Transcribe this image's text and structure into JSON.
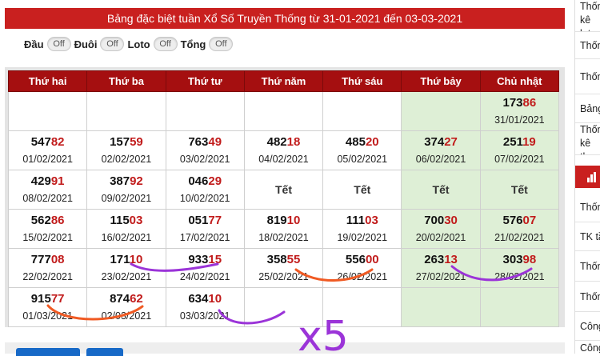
{
  "header": {
    "title": "Bảng đặc biệt tuần Xổ Số Truyền Thống từ 31-01-2021 đến 03-03-2021"
  },
  "toggles": [
    {
      "label": "Đầu",
      "state": "Off"
    },
    {
      "label": "Đuôi",
      "state": "Off"
    },
    {
      "label": "Loto",
      "state": "Off"
    },
    {
      "label": "Tổng",
      "state": "Off"
    }
  ],
  "table": {
    "headers": [
      "Thứ hai",
      "Thứ ba",
      "Thứ tư",
      "Thứ năm",
      "Thứ sáu",
      "Thứ bảy",
      "Chủ nhật"
    ],
    "rows": [
      [
        {
          "head": "",
          "tail": "",
          "date": ""
        },
        {
          "head": "",
          "tail": "",
          "date": ""
        },
        {
          "head": "",
          "tail": "",
          "date": ""
        },
        {
          "head": "",
          "tail": "",
          "date": ""
        },
        {
          "head": "",
          "tail": "",
          "date": ""
        },
        {
          "head": "",
          "tail": "",
          "date": ""
        },
        {
          "head": "173",
          "tail": "86",
          "date": "31/01/2021"
        }
      ],
      [
        {
          "head": "547",
          "tail": "82",
          "date": "01/02/2021"
        },
        {
          "head": "157",
          "tail": "59",
          "date": "02/02/2021"
        },
        {
          "head": "763",
          "tail": "49",
          "date": "03/02/2021"
        },
        {
          "head": "482",
          "tail": "18",
          "date": "04/02/2021"
        },
        {
          "head": "485",
          "tail": "20",
          "date": "05/02/2021"
        },
        {
          "head": "374",
          "tail": "27",
          "date": "06/02/2021"
        },
        {
          "head": "251",
          "tail": "19",
          "date": "07/02/2021"
        }
      ],
      [
        {
          "head": "429",
          "tail": "91",
          "date": "08/02/2021"
        },
        {
          "head": "387",
          "tail": "92",
          "date": "09/02/2021"
        },
        {
          "head": "046",
          "tail": "29",
          "date": "10/02/2021"
        },
        {
          "tet": "Tết"
        },
        {
          "tet": "Tết"
        },
        {
          "tet": "Tết"
        },
        {
          "tet": "Tết"
        }
      ],
      [
        {
          "head": "562",
          "tail": "86",
          "date": "15/02/2021"
        },
        {
          "head": "115",
          "tail": "03",
          "date": "16/02/2021"
        },
        {
          "head": "051",
          "tail": "77",
          "date": "17/02/2021"
        },
        {
          "head": "819",
          "tail": "10",
          "date": "18/02/2021"
        },
        {
          "head": "111",
          "tail": "03",
          "date": "19/02/2021"
        },
        {
          "head": "700",
          "tail": "30",
          "date": "20/02/2021"
        },
        {
          "head": "576",
          "tail": "07",
          "date": "21/02/2021"
        }
      ],
      [
        {
          "head": "777",
          "tail": "08",
          "date": "22/02/2021"
        },
        {
          "head": "171",
          "tail": "10",
          "date": "23/02/2021"
        },
        {
          "head": "933",
          "tail": "15",
          "date": "24/02/2021"
        },
        {
          "head": "358",
          "tail": "55",
          "date": "25/02/2021"
        },
        {
          "head": "556",
          "tail": "00",
          "date": "26/02/2021"
        },
        {
          "head": "263",
          "tail": "13",
          "date": "27/02/2021"
        },
        {
          "head": "303",
          "tail": "98",
          "date": "28/02/2021"
        }
      ],
      [
        {
          "head": "915",
          "tail": "77",
          "date": "01/03/2021"
        },
        {
          "head": "874",
          "tail": "62",
          "date": "02/03/2021"
        },
        {
          "head": "634",
          "tail": "10",
          "date": "03/03/2021"
        },
        {
          "head": "",
          "tail": "",
          "date": ""
        },
        {
          "head": "",
          "tail": "",
          "date": ""
        },
        {
          "head": "",
          "tail": "",
          "date": ""
        },
        {
          "head": "",
          "tail": "",
          "date": ""
        }
      ]
    ]
  },
  "annotation": {
    "text": "x5",
    "colors": {
      "purple": "#9b34d8",
      "orange": "#f05a23"
    }
  },
  "sidebar": {
    "items": [
      "Thống kê loto",
      "Thống",
      "Thống",
      "Bảng",
      "Thống kê theo",
      "Thống",
      "TK tần",
      "Thống",
      "Thống",
      "Công",
      "Công"
    ]
  },
  "colors": {
    "header_red": "#c9201f",
    "table_head": "#a50f10",
    "weekend_bg": "#deefd6",
    "tail_red": "#c11b1b"
  }
}
